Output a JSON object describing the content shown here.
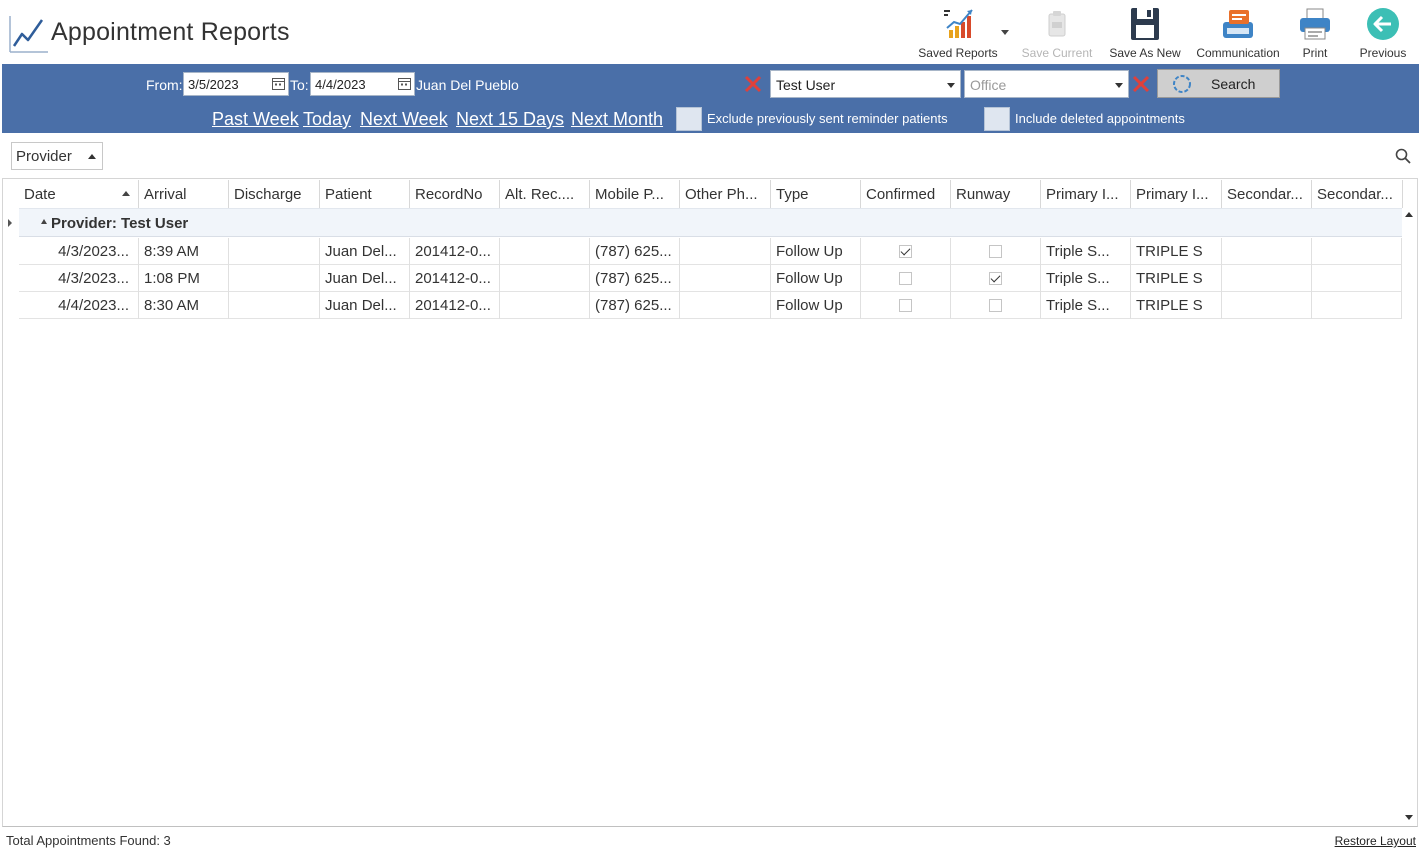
{
  "app": {
    "title": "Appointment Reports"
  },
  "toolbar": {
    "saved_reports": "Saved Reports",
    "save_current": "Save Current",
    "save_as_new": "Save As New",
    "communication": "Communication",
    "print": "Print",
    "previous": "Previous"
  },
  "filters": {
    "from_label": "From:",
    "from_value": "3/5/2023",
    "to_label": "To:",
    "to_value": "4/4/2023",
    "patient_name": "Juan Del Pueblo",
    "provider_value": "Test User",
    "office_placeholder": "Office",
    "search_label": "Search",
    "quick_ranges": [
      "Past Week",
      "Today",
      "Next Week",
      "Next 15 Days",
      "Next Month"
    ],
    "exclude_reminder_label": "Exclude previously sent reminder patients",
    "include_deleted_label": "Include deleted appointments",
    "exclude_reminder_checked": false,
    "include_deleted_checked": false
  },
  "grouping": {
    "group_by": "Provider"
  },
  "grid": {
    "columns": [
      "Date",
      "Arrival",
      "Discharge",
      "Patient",
      "RecordNo",
      "Alt. Rec....",
      "Mobile P...",
      "Other Ph...",
      "Type",
      "Confirmed",
      "Runway",
      "Primary I...",
      "Primary I...",
      "Secondar...",
      "Secondar..."
    ],
    "group_header": "Provider: Test User",
    "rows": [
      {
        "date": "4/3/2023...",
        "arrival": "8:39 AM",
        "discharge": "",
        "patient": "Juan Del...",
        "record_no": "201412-0...",
        "alt_rec": "",
        "mobile": "(787) 625...",
        "other_phone": "",
        "type": "Follow Up",
        "confirmed": true,
        "runway": false,
        "primary_ins": "Triple S...",
        "primary_ins2": "TRIPLE S",
        "secondary_ins": "",
        "secondary_ins2": ""
      },
      {
        "date": "4/3/2023...",
        "arrival": "1:08 PM",
        "discharge": "",
        "patient": "Juan Del...",
        "record_no": "201412-0...",
        "alt_rec": "",
        "mobile": "(787) 625...",
        "other_phone": "",
        "type": "Follow Up",
        "confirmed": false,
        "runway": true,
        "primary_ins": "Triple S...",
        "primary_ins2": "TRIPLE S",
        "secondary_ins": "",
        "secondary_ins2": ""
      },
      {
        "date": "4/4/2023...",
        "arrival": "8:30 AM",
        "discharge": "",
        "patient": "Juan Del...",
        "record_no": "201412-0...",
        "alt_rec": "",
        "mobile": "(787) 625...",
        "other_phone": "",
        "type": "Follow Up",
        "confirmed": false,
        "runway": false,
        "primary_ins": "Triple S...",
        "primary_ins2": "TRIPLE S",
        "secondary_ins": "",
        "secondary_ins2": ""
      }
    ]
  },
  "footer": {
    "total_text": "Total Appointments Found: 3",
    "restore_layout": "Restore Layout"
  },
  "colors": {
    "filter_band": "#4a6fa8",
    "clear_x": "#e0403a",
    "group_row": "#f1f5fa"
  }
}
